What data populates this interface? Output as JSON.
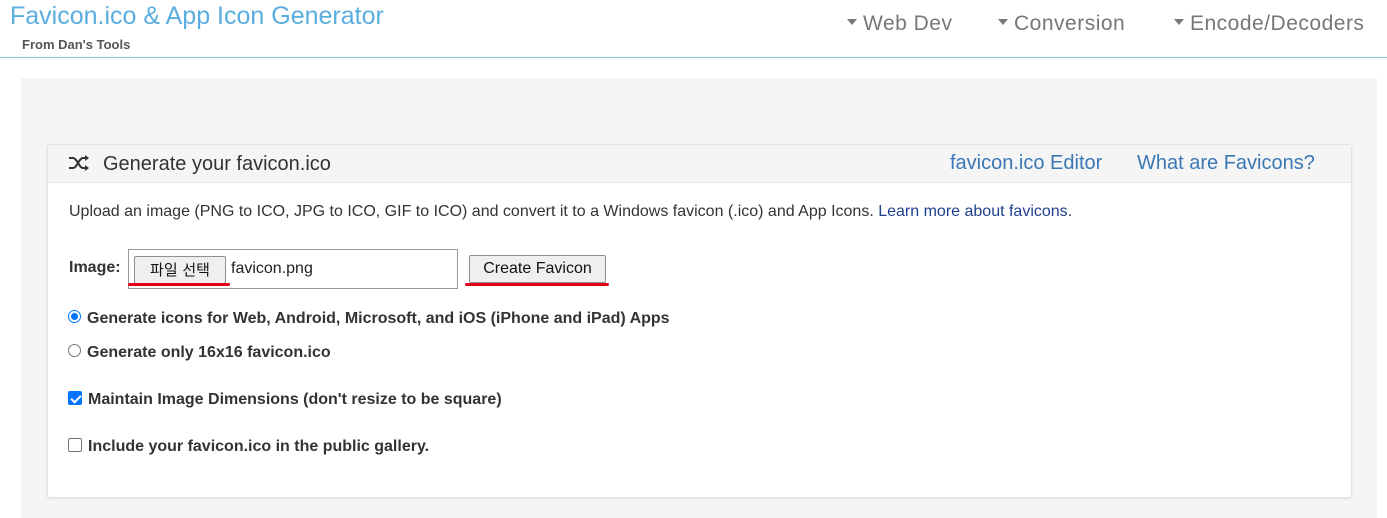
{
  "header": {
    "title": "Favicon.ico & App Icon Generator",
    "subtitle": "From Dan's Tools",
    "nav": [
      {
        "label": "Web Dev",
        "icon": "caret-down-icon"
      },
      {
        "label": "Conversion",
        "icon": "caret-down-icon"
      },
      {
        "label": "Encode/Decoders",
        "icon": "caret-down-icon"
      }
    ]
  },
  "panel": {
    "icon": "shuffle-icon",
    "title": "Generate your favicon.ico",
    "links": [
      "favicon.ico Editor",
      "What are Favicons?"
    ],
    "intro_text": "Upload an image (PNG to ICO, JPG to ICO, GIF to ICO) and convert it to a Windows favicon (.ico) and App Icons.",
    "intro_link": "Learn more about favicons",
    "intro_end": "."
  },
  "form": {
    "image_label": "Image:",
    "file_button_label": "파일 선택",
    "file_name": "favicon.png",
    "create_button_label": "Create Favicon",
    "options": [
      {
        "type": "radio",
        "label": "Generate icons for Web, Android, Microsoft, and iOS (iPhone and iPad) Apps",
        "checked": true
      },
      {
        "type": "radio",
        "label": "Generate only 16x16 favicon.ico",
        "checked": false
      },
      {
        "type": "checkbox",
        "label": "Maintain Image Dimensions (don't resize to be square)",
        "checked": true
      },
      {
        "type": "checkbox",
        "label": "Include your favicon.ico in the public gallery.",
        "checked": false
      }
    ]
  },
  "colors": {
    "brand": "#5aaddf",
    "link": "#3a78b5",
    "highlight_underline": "#e0001b",
    "control_accent": "#0075ff"
  }
}
